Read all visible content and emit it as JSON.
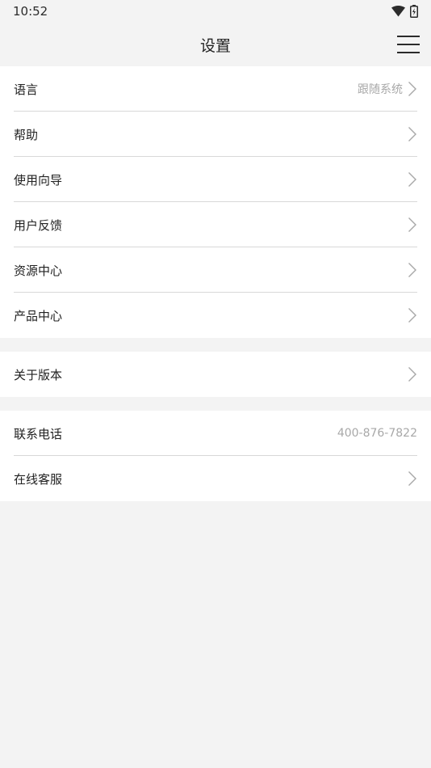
{
  "status_bar": {
    "time": "10:52"
  },
  "header": {
    "title": "设置"
  },
  "groups": [
    [
      {
        "label": "语言",
        "value": "跟随系统",
        "chevron": true
      },
      {
        "label": "帮助",
        "value": "",
        "chevron": true
      },
      {
        "label": "使用向导",
        "value": "",
        "chevron": true
      },
      {
        "label": "用户反馈",
        "value": "",
        "chevron": true
      },
      {
        "label": "资源中心",
        "value": "",
        "chevron": true
      },
      {
        "label": "产品中心",
        "value": "",
        "chevron": true
      }
    ],
    [
      {
        "label": "关于版本",
        "value": "",
        "chevron": true
      }
    ],
    [
      {
        "label": "联系电话",
        "value": "400-876-7822",
        "chevron": false
      },
      {
        "label": "在线客服",
        "value": "",
        "chevron": true
      }
    ]
  ],
  "icons": {
    "wifi": "wifi-icon",
    "battery": "battery-icon",
    "menu": "menu-icon",
    "chevron": "chevron-right-icon"
  },
  "colors": {
    "background": "#f3f3f3",
    "card": "#ffffff",
    "divider": "#d8d8d8",
    "secondary_text": "#a8a8a8"
  }
}
